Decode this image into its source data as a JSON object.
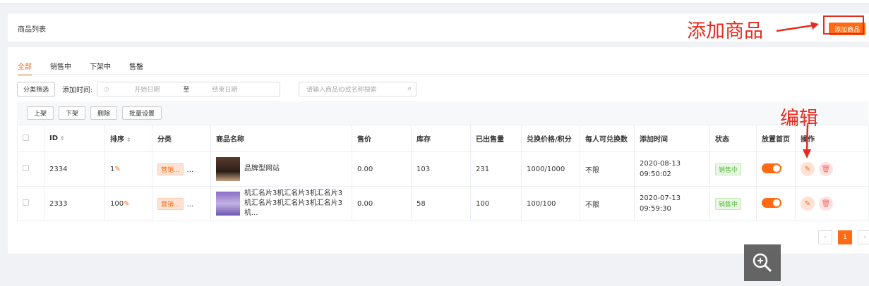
{
  "header": {
    "title": "商品列表",
    "add_button": "添加商品"
  },
  "annotations": {
    "add_label": "添加商品",
    "edit_label": "编辑"
  },
  "tabs": [
    {
      "label": "全部",
      "active": true
    },
    {
      "label": "销售中",
      "active": false
    },
    {
      "label": "下架中",
      "active": false
    },
    {
      "label": "售罄",
      "active": false
    }
  ],
  "filter": {
    "category_button": "分类筛选",
    "date_label": "添加时间:",
    "start_placeholder": "开始日期",
    "to": "至",
    "end_placeholder": "结束日期",
    "search_placeholder": "请输入商品ID或名称搜索"
  },
  "bulk": {
    "on_shelf": "上架",
    "off_shelf": "下架",
    "delete": "删除",
    "batch_settings": "批量设置"
  },
  "table": {
    "columns": [
      "ID",
      "排序",
      "分类",
      "商品名称",
      "售价",
      "库存",
      "已出售量",
      "兑换价格/积分",
      "每人可兑换数",
      "添加时间",
      "状态",
      "放置首页",
      "操作"
    ],
    "rows": [
      {
        "id": "2334",
        "sort": "1",
        "category": "营销...",
        "more": "...",
        "name": "品牌型网站",
        "price": "0.00",
        "stock": "103",
        "sold": "231",
        "exchange": "1000/1000",
        "limit": "不限",
        "added": "2020-08-13 09:50:02",
        "status": "销售中",
        "home": true
      },
      {
        "id": "2333",
        "sort": "100",
        "category": "营销...",
        "more": "...",
        "name": "机汇名片3机汇名片3机汇名片3机汇名片3机汇名片3机汇名片3机...",
        "price": "0.00",
        "stock": "58",
        "sold": "100",
        "exchange": "100/100",
        "limit": "不限",
        "added": "2020-07-13 09:59:30",
        "status": "销售中",
        "home": true
      }
    ]
  },
  "pagination": {
    "current": "1",
    "prev": "‹",
    "next": "›"
  },
  "colors": {
    "accent": "#ff6a13",
    "annotation": "#e52b1e",
    "status_green": "#57b83b"
  }
}
